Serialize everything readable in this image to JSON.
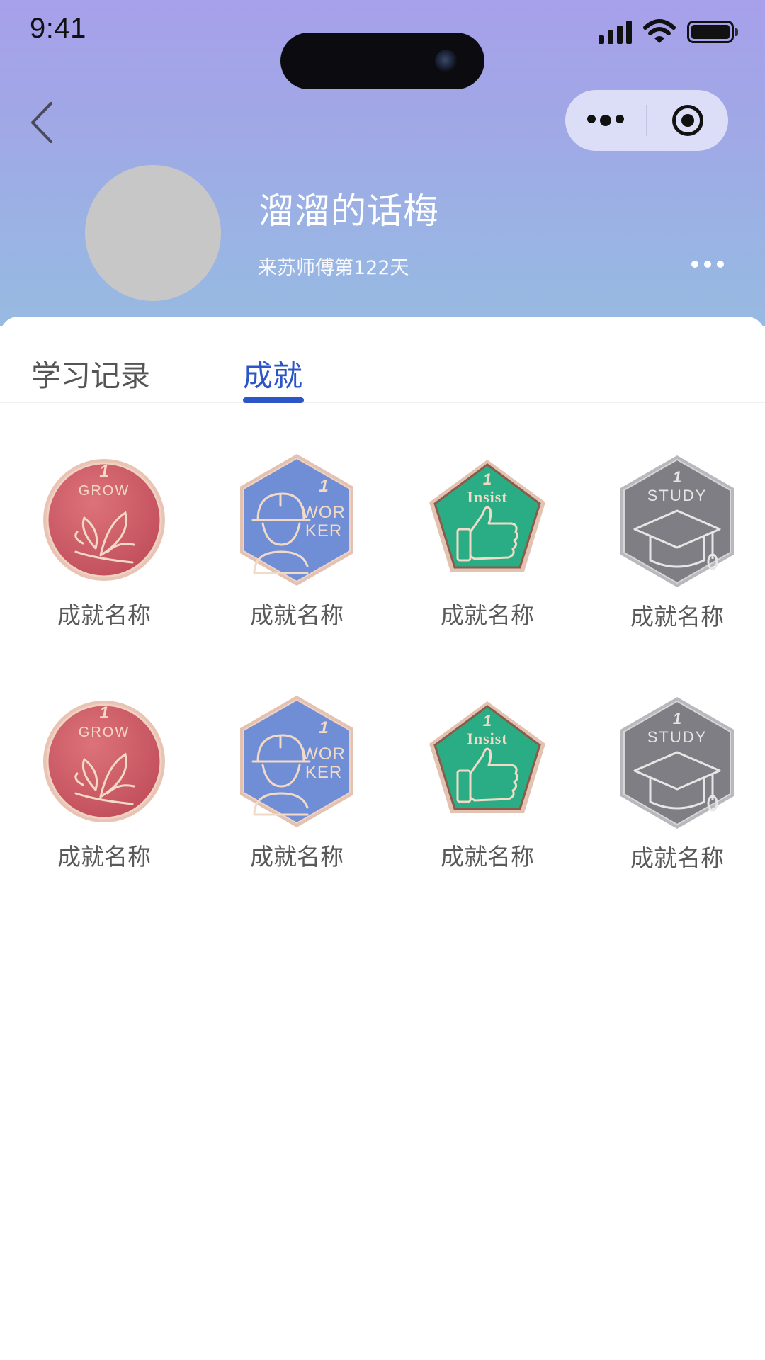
{
  "status_bar": {
    "time": "9:41"
  },
  "nav": {
    "back_icon": "chevron-left-icon",
    "capsule_icons": [
      "more-dots-icon",
      "target-icon"
    ]
  },
  "profile": {
    "name": "溜溜的话梅",
    "days_text": "来苏师傅第122天",
    "more_icon": "more-dots-icon"
  },
  "tabs": [
    {
      "label": "学习记录",
      "active": false
    },
    {
      "label": "成就",
      "active": true
    }
  ],
  "accent_color": "#2c56c7",
  "achievements": [
    {
      "label": "成就名称",
      "badge_text": "GROW",
      "badge_number": "1",
      "shape": "circle",
      "color": "#cf5c66",
      "icon": "leaf-icon"
    },
    {
      "label": "成就名称",
      "badge_text": "WOR KER",
      "badge_number": "1",
      "shape": "hexagon",
      "color": "#6f8ed6",
      "icon": "worker-icon"
    },
    {
      "label": "成就名称",
      "badge_text": "Insist",
      "badge_number": "1",
      "shape": "pentagon",
      "color": "#2aad84",
      "icon": "thumbs-up-icon"
    },
    {
      "label": "成就名称",
      "badge_text": "STUDY",
      "badge_number": "1",
      "shape": "hexagon",
      "color": "#7e7e84",
      "icon": "graduation-cap-icon"
    },
    {
      "label": "成就名称",
      "badge_text": "GROW",
      "badge_number": "1",
      "shape": "circle",
      "color": "#cf5c66",
      "icon": "leaf-icon"
    },
    {
      "label": "成就名称",
      "badge_text": "WOR KER",
      "badge_number": "1",
      "shape": "hexagon",
      "color": "#6f8ed6",
      "icon": "worker-icon"
    },
    {
      "label": "成就名称",
      "badge_text": "Insist",
      "badge_number": "1",
      "shape": "pentagon",
      "color": "#2aad84",
      "icon": "thumbs-up-icon"
    },
    {
      "label": "成就名称",
      "badge_text": "STUDY",
      "badge_number": "1",
      "shape": "hexagon",
      "color": "#7e7e84",
      "icon": "graduation-cap-icon"
    }
  ]
}
